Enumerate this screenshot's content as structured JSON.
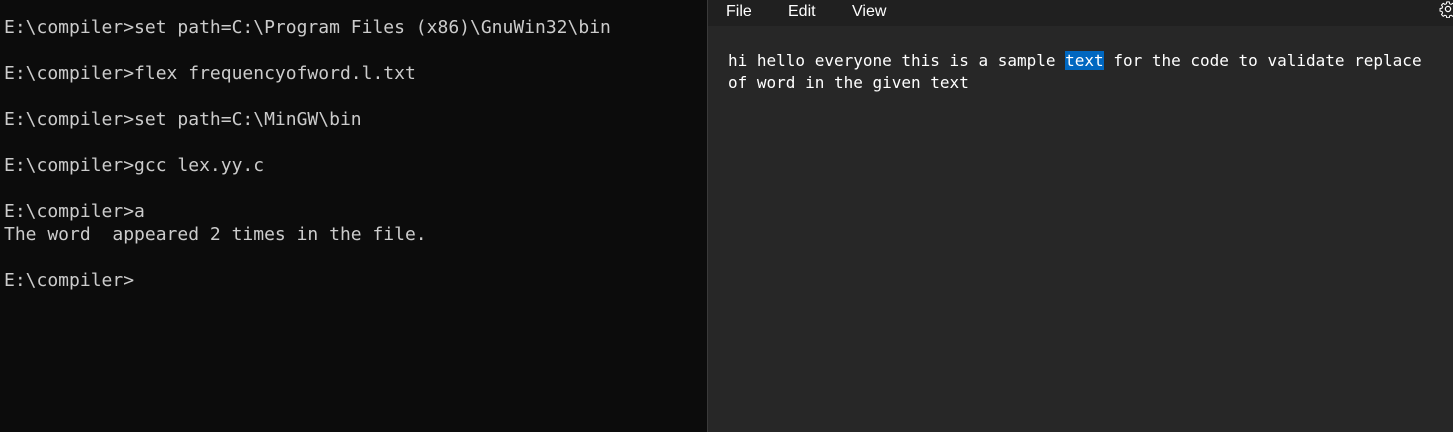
{
  "terminal": {
    "lines": [
      "E:\\compiler>set path=C:\\Program Files (x86)\\GnuWin32\\bin",
      "",
      "E:\\compiler>flex frequencyofword.l.txt",
      "",
      "E:\\compiler>set path=C:\\MinGW\\bin",
      "",
      "E:\\compiler>gcc lex.yy.c",
      "",
      "E:\\compiler>a",
      "The word  appeared 2 times in the file.",
      "",
      "E:\\compiler>"
    ]
  },
  "notepad": {
    "menu": {
      "file": "File",
      "edit": "Edit",
      "view": "View"
    },
    "settings_icon": "gear-icon",
    "text": {
      "line1_before": "hi hello everyone this is a sample ",
      "line1_selected": "text",
      "line1_after": " for the code to validate replace",
      "line2": "of word in the given text"
    },
    "selection_color": "#0067c0"
  },
  "colors": {
    "terminal_bg": "#0c0c0c",
    "terminal_fg": "#cccccc",
    "notepad_bg": "#272727",
    "menubar_bg": "#202020"
  }
}
